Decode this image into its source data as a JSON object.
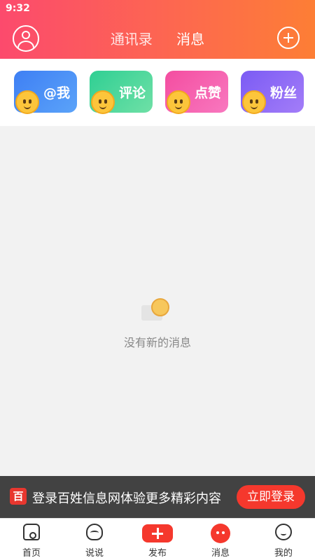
{
  "status_bar": {
    "time": "9:32"
  },
  "header": {
    "tabs": [
      {
        "label": "通讯录",
        "active": false
      },
      {
        "label": "消息",
        "active": true
      }
    ]
  },
  "categories": [
    {
      "label": "@我",
      "icon": "emoji-icon"
    },
    {
      "label": "评论",
      "icon": "emoji-comment-icon"
    },
    {
      "label": "点赞",
      "icon": "emoji-like-icon"
    },
    {
      "label": "粉丝",
      "icon": "emoji-fans-icon"
    }
  ],
  "empty_state": {
    "text": "没有新的消息"
  },
  "login_banner": {
    "logo_text": "百",
    "text": "登录百姓信息网体验更多精彩内容",
    "button_label": "立即登录"
  },
  "bottom_nav": [
    {
      "label": "首页",
      "icon": "home-icon"
    },
    {
      "label": "说说",
      "icon": "talk-icon"
    },
    {
      "label": "发布",
      "icon": "publish-icon"
    },
    {
      "label": "消息",
      "icon": "message-icon"
    },
    {
      "label": "我的",
      "icon": "mine-icon"
    }
  ],
  "colors": {
    "accent": "#f5382d",
    "header_start": "#fc4a6d",
    "header_end": "#fd7e35"
  }
}
